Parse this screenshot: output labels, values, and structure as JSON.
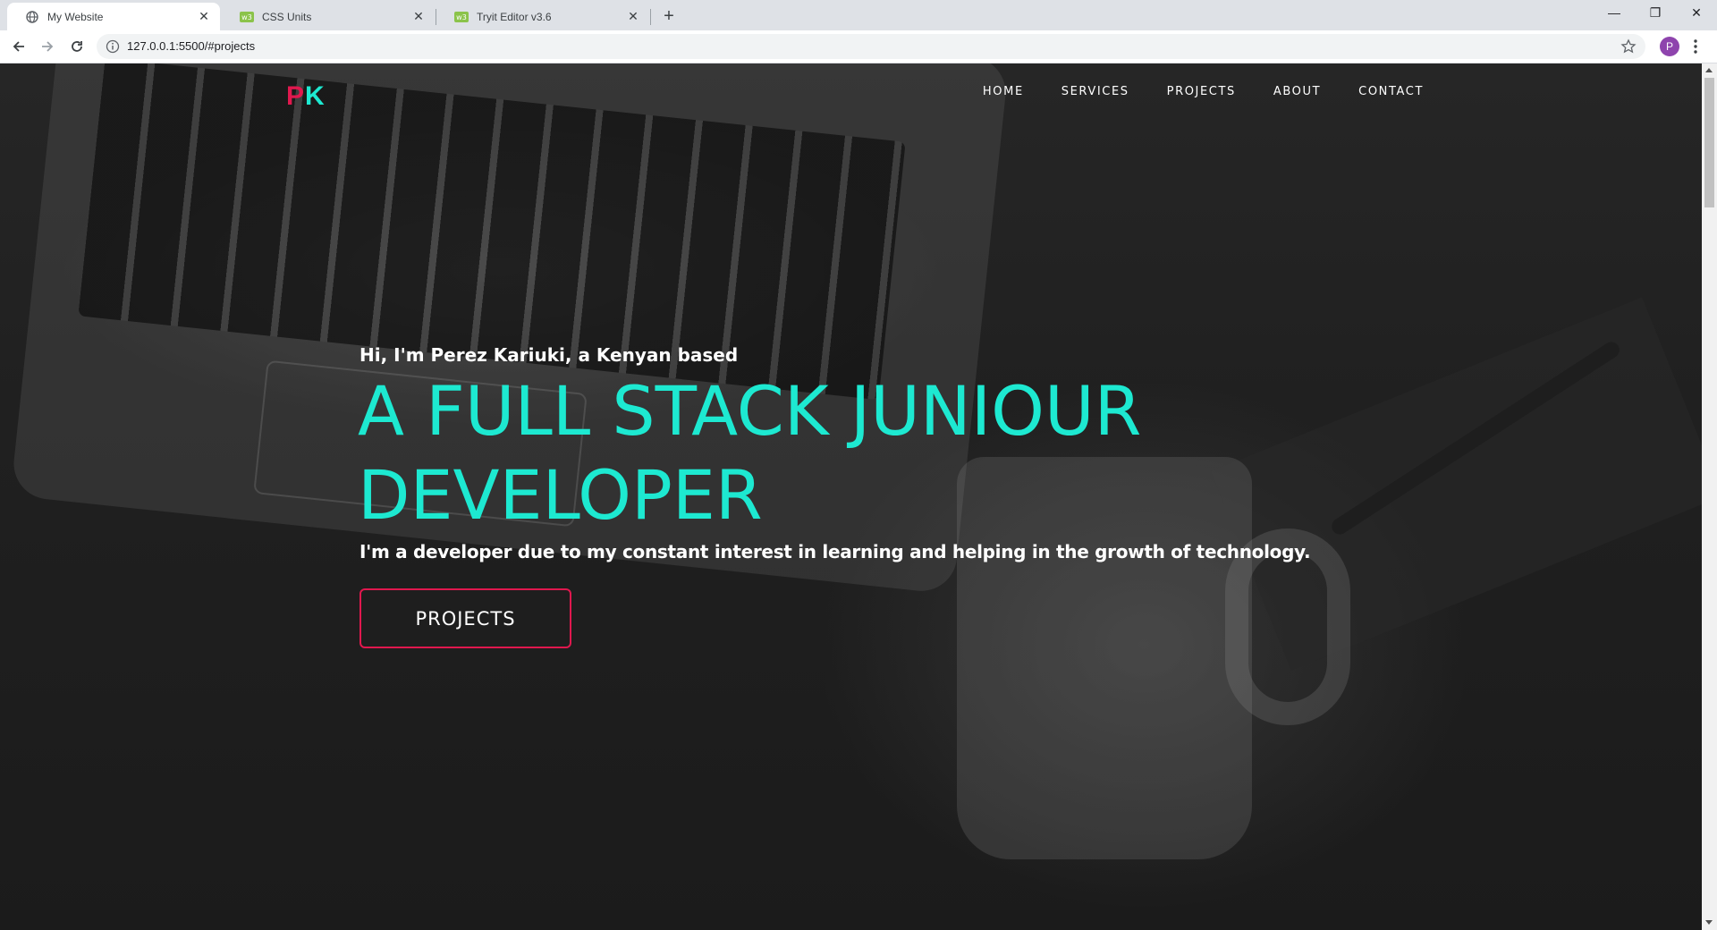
{
  "browser": {
    "tabs": [
      {
        "title": "My Website",
        "icon": "globe-icon",
        "active": true
      },
      {
        "title": "CSS Units",
        "icon": "w3schools-icon",
        "active": false
      },
      {
        "title": "Tryit Editor v3.6",
        "icon": "w3schools-icon",
        "active": false
      }
    ],
    "close_glyph": "✕",
    "new_tab_glyph": "+",
    "url": "127.0.0.1:5500/#projects",
    "profile_initial": "P",
    "window_controls": {
      "minimize": "—",
      "restore": "❐",
      "close": "✕"
    }
  },
  "site": {
    "logo_first": "P",
    "logo_second": "K",
    "nav": [
      "HOME",
      "SERVICES",
      "PROJECTS",
      "ABOUT",
      "CONTACT"
    ],
    "hero": {
      "intro": "Hi, I'm Perez Kariuki, a Kenyan based",
      "headline": "A FULL STACK JUNIOUR DEVELOPER",
      "tagline": "I'm a developer due to my constant interest in learning and helping in the growth of technology.",
      "cta": "PROJECTS"
    }
  },
  "colors": {
    "accent_teal": "#1de9d1",
    "accent_red": "#e0184e",
    "profile_purple": "#8e44ad"
  }
}
